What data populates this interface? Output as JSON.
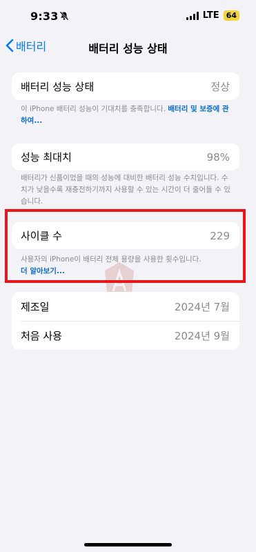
{
  "status_bar": {
    "time": "9:33",
    "network": "LTE",
    "battery": "64"
  },
  "nav": {
    "back_label": "배터리",
    "title": "배터리 성능 상태"
  },
  "health": {
    "label": "배터리 성능 상태",
    "value": "정상",
    "footnote_text": "이 iPhone 배터리 성능이 기대치를 충족합니다. ",
    "footnote_link": "배터리 및 보증에 관하여..."
  },
  "max_capacity": {
    "label": "성능 최대치",
    "value": "98%",
    "footnote_text": "배터리가 신품이었을 때의 성능에 대비한 배터리 성능 수치입니다. 수치가 낮을수록 재충전하기까지 사용할 수 있는 시간이 더 줄어들 수 있습니다."
  },
  "cycle": {
    "label": "사이클 수",
    "value": "229",
    "footnote_text": "사용자의 iPhone이 배터리 전체 용량을 사용한 횟수입니다.",
    "footnote_link": "더 알아보기..."
  },
  "dates": {
    "manufacture_label": "제조일",
    "manufacture_value": "2024년 7월",
    "first_use_label": "처음 사용",
    "first_use_value": "2024년 9월"
  },
  "colors": {
    "accent": "#007aff",
    "highlight": "#e8161b",
    "background": "#f2f2f7",
    "battery_badge": "#f4d23a"
  }
}
